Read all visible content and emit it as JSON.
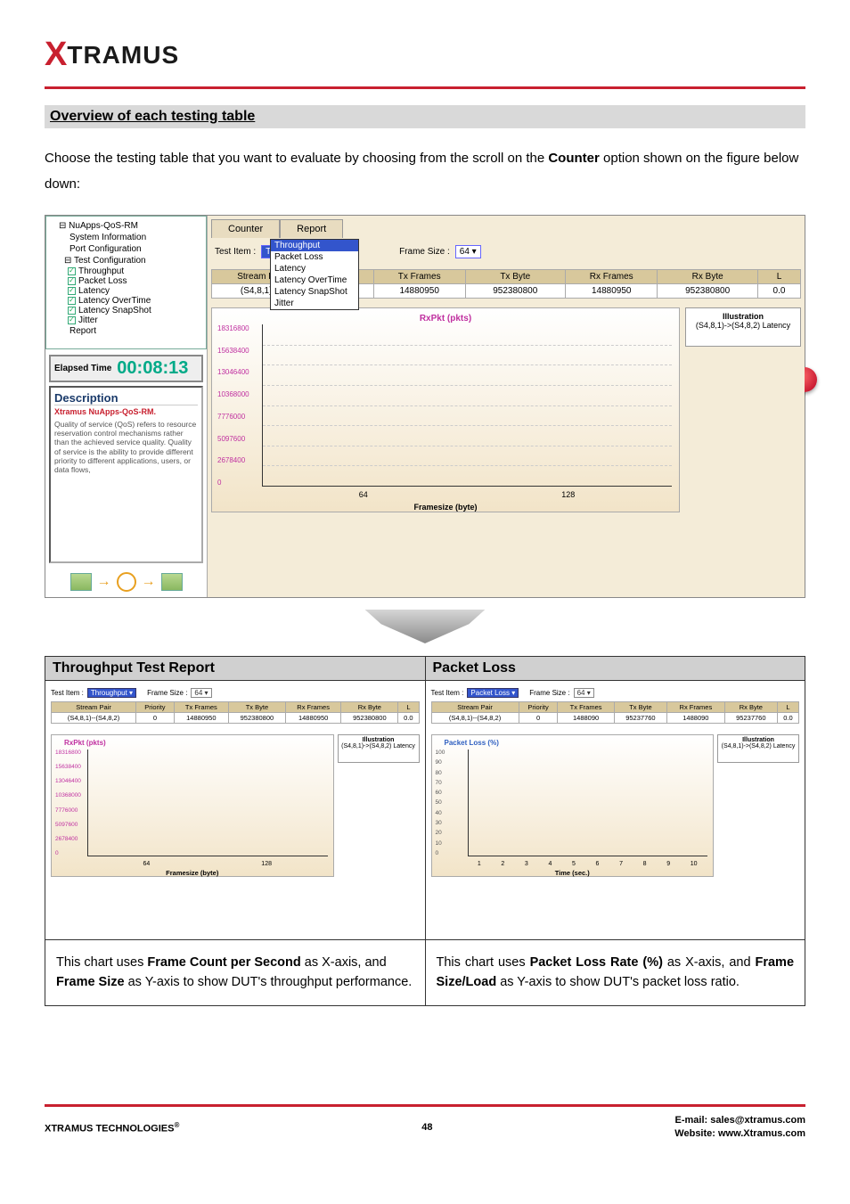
{
  "logo": {
    "x": "X",
    "text": "TRAMUS"
  },
  "section_title": "Overview of each testing table",
  "intro_a": "Choose the testing table that you want to evaluate by choosing from the scroll on the ",
  "intro_b": "Counter",
  "intro_c": " option shown on the figure below down:",
  "tree": {
    "root": "NuApps-QoS-RM",
    "sys": "System Information",
    "port": "Port Configuration",
    "test": "Test Configuration",
    "thr": "Throughput",
    "pkt": "Packet Loss",
    "lat": "Latency",
    "latot": "Latency OverTime",
    "latss": "Latency SnapShot",
    "jit": "Jitter",
    "rep": "Report"
  },
  "elapsed": {
    "label": "Elapsed Time",
    "value": "00:08:13"
  },
  "desc": {
    "title": "Description",
    "sub": "Xtramus NuApps-QoS-RM.",
    "text": "Quality of service (QoS) refers to resource reservation control mechanisms rather than the achieved service quality. Quality of service is the ability to provide different priority to different applications, users, or data flows,"
  },
  "tabs": {
    "counter": "Counter",
    "report": "Report"
  },
  "controls": {
    "test_item": "Test Item :",
    "test_val": "Throughput",
    "frame_size": "Frame Size :",
    "frame_val": "64",
    "dd": [
      "Throughput",
      "Packet Loss",
      "Latency",
      "Latency OverTime",
      "Latency SnapShot",
      "Jitter"
    ]
  },
  "table": {
    "headers": [
      "Stream Pair",
      "Priority",
      "Tx Frames",
      "Tx Byte",
      "Rx Frames",
      "Rx Byte",
      "L"
    ],
    "row": [
      "(S4,8,1)---",
      "",
      "14880950",
      "952380800",
      "14880950",
      "952380800",
      "0.0"
    ]
  },
  "chart_data": {
    "type": "bar",
    "title": "RxPkt (pkts)",
    "y_ticks": [
      "18316800",
      "15638400",
      "13046400",
      "10368000",
      "7776000",
      "5097600",
      "2678400",
      "0"
    ],
    "x_ticks": [
      "64",
      "128"
    ],
    "xlabel": "Framesize (byte)",
    "illus_title": "Illustration",
    "illus_text": "(S4,8,1)->(S4,8,2) Latency"
  },
  "two_col": {
    "left": {
      "header": "Throughput Test Report",
      "controls": {
        "ti": "Test Item :",
        "tv": "Throughput",
        "fs": "Frame Size :",
        "fv": "64"
      },
      "table": {
        "headers": [
          "Stream Pair",
          "Priority",
          "Tx Frames",
          "Tx Byte",
          "Rx Frames",
          "Rx Byte",
          "L"
        ],
        "row": [
          "(S4,8,1)--(S4,8,2)",
          "0",
          "14880950",
          "952380800",
          "14880950",
          "952380800",
          "0.0"
        ]
      },
      "chart": {
        "title": "RxPkt (pkts)",
        "y": [
          "18316800",
          "15638400",
          "13046400",
          "10368000",
          "7776000",
          "5097600",
          "2678400",
          "0"
        ],
        "x": [
          "64",
          "128"
        ],
        "xlabel": "Framesize (byte)",
        "illus_t": "Illustration",
        "illus": "(S4,8,1)->(S4,8,2) Latency"
      },
      "footer_a": "This chart uses ",
      "footer_b": "Frame Count per Second",
      "footer_c": " as X-axis, and ",
      "footer_d": "Frame Size",
      "footer_e": " as Y-axis to show DUT's throughput performance."
    },
    "right": {
      "header": "Packet Loss",
      "controls": {
        "ti": "Test Item :",
        "tv": "Packet Loss",
        "fs": "Frame Size :",
        "fv": "64"
      },
      "table": {
        "headers": [
          "Stream Pair",
          "Priority",
          "Tx Frames",
          "Tx Byte",
          "Rx Frames",
          "Rx Byte",
          "L"
        ],
        "row": [
          "(S4,8,1)--(S4,8,2)",
          "0",
          "1488090",
          "95237760",
          "1488090",
          "95237760",
          "0.0"
        ]
      },
      "chart": {
        "title": "Packet Loss (%)",
        "y": [
          "100",
          "90",
          "80",
          "70",
          "60",
          "50",
          "40",
          "30",
          "20",
          "10",
          "0"
        ],
        "x": [
          "1",
          "2",
          "3",
          "4",
          "5",
          "6",
          "7",
          "8",
          "9",
          "10"
        ],
        "xlabel": "Time (sec.)",
        "illus_t": "Illustration",
        "illus": "(S4,8,1)->(S4,8,2) Latency"
      },
      "footer_a": "This chart uses ",
      "footer_b": "Packet Loss Rate (%)",
      "footer_c": " as X-axis, and ",
      "footer_d": "Frame Size/Load",
      "footer_e": " as Y-axis to show DUT's packet loss ratio."
    }
  },
  "footer": {
    "left": "XTRAMUS TECHNOLOGIES",
    "page": "48",
    "email": "E-mail: sales@xtramus.com",
    "web": "Website:  www.Xtramus.com"
  }
}
